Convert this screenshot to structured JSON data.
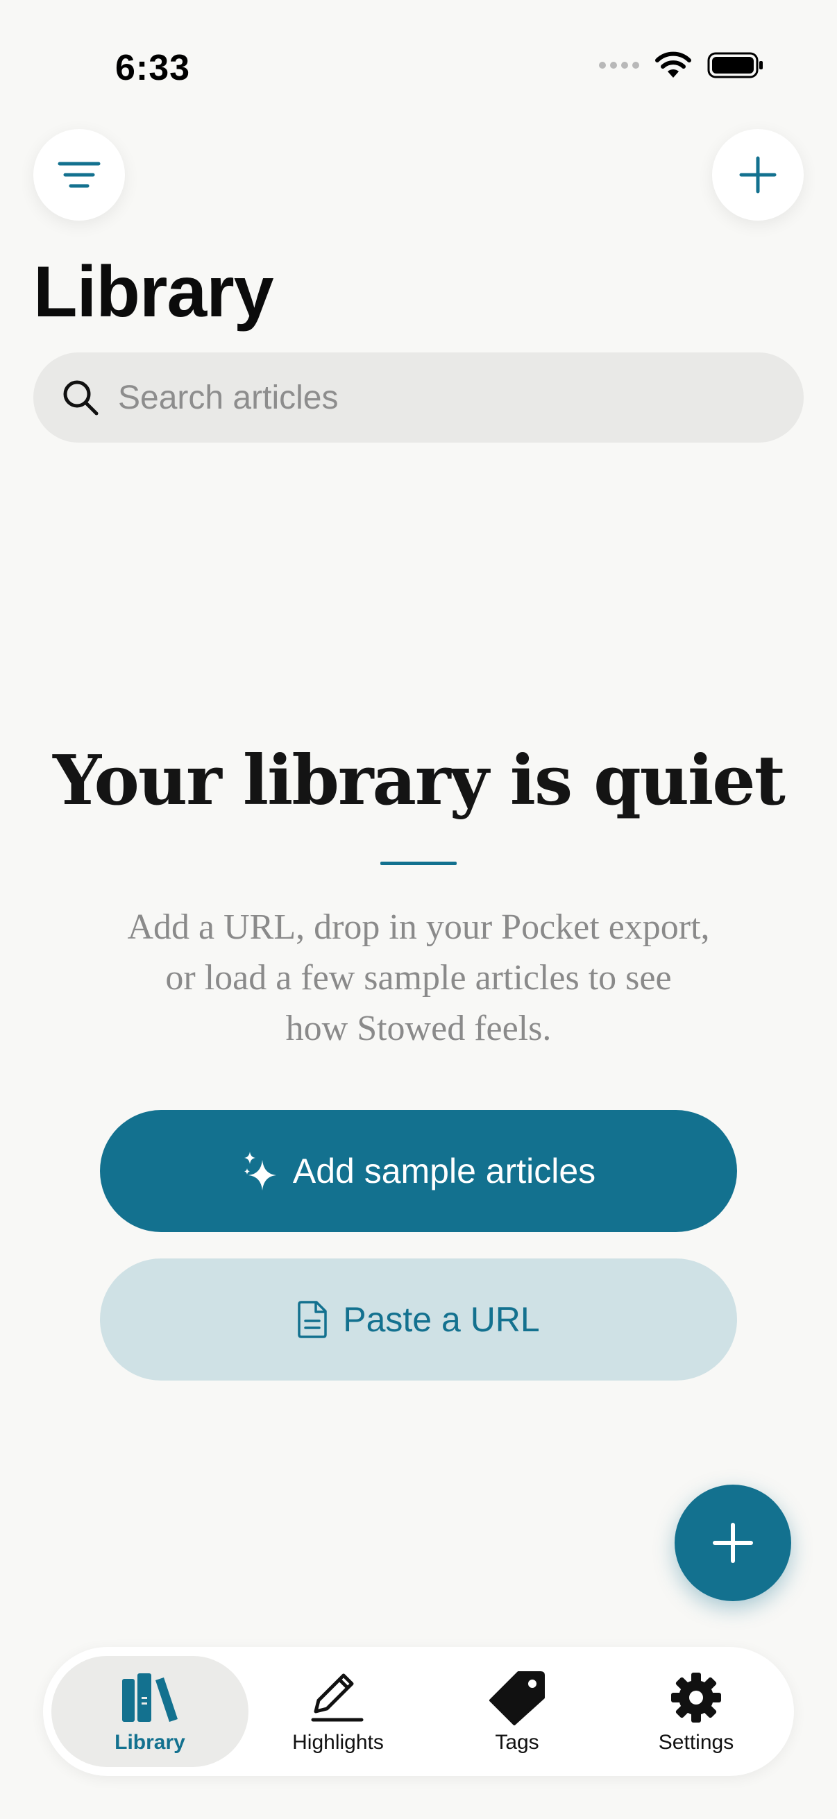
{
  "status_bar": {
    "time": "6:33"
  },
  "header": {
    "title": "Library",
    "filter_icon": "filter-lines-icon",
    "add_icon": "plus-icon"
  },
  "search": {
    "placeholder": "Search articles",
    "value": ""
  },
  "empty_state": {
    "title": "Your library is quiet",
    "description_lines": [
      "Add a URL, drop in your Pocket export,",
      "or load a few sample articles to see",
      "how Stowed feels."
    ],
    "primary_button": {
      "label": "Add sample articles",
      "icon": "sparkles-icon"
    },
    "secondary_button": {
      "label": "Paste a URL",
      "icon": "document-icon"
    }
  },
  "fab": {
    "icon": "plus-icon"
  },
  "tabbar": {
    "active": "Library",
    "items": [
      {
        "label": "Library",
        "icon": "books-icon"
      },
      {
        "label": "Highlights",
        "icon": "highlighter-icon"
      },
      {
        "label": "Tags",
        "icon": "tag-icon"
      },
      {
        "label": "Settings",
        "icon": "gear-icon"
      }
    ]
  },
  "colors": {
    "accent": "#13718f",
    "accent_light": "#cfe1e5",
    "background": "#f8f8f6",
    "search_bg": "#e9e9e7"
  }
}
